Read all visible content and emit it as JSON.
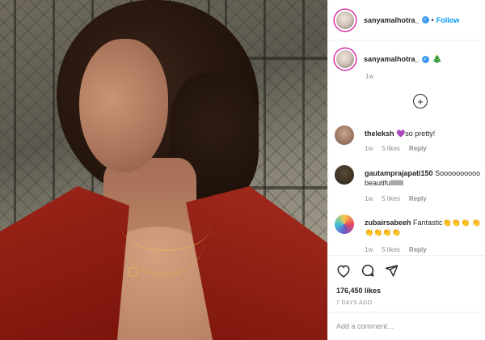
{
  "post": {
    "username": "sanyamalhotra_",
    "follow_label": "Follow",
    "header_dot": "•",
    "caption_emoji": "🎄",
    "caption_time": "1w",
    "verified_mark": "✓"
  },
  "comments": [
    {
      "user": "theleksh",
      "text": "💜so pretty!",
      "time": "1w",
      "likes": "5 likes",
      "reply": "Reply"
    },
    {
      "user": "gautamprajapati150",
      "text": "Soooooooooo beautifullllllll",
      "time": "1w",
      "likes": "5 likes",
      "reply": "Reply"
    },
    {
      "user": "zubairsabeeh",
      "text": "Fantastic👏👏👏 👏👏👏👏👏",
      "time": "1w",
      "likes": "5 likes",
      "reply": "Reply"
    }
  ],
  "load_more_symbol": "+",
  "stats": {
    "likes": "176,450 likes",
    "posted_ago": "7 DAYS AGO"
  },
  "add_comment": {
    "placeholder": "Add a comment..."
  },
  "icons": [
    "heart-icon",
    "comment-icon",
    "share-icon",
    "plus-circle-icon",
    "verified-icon"
  ],
  "colors": {
    "accent": "#0095f6",
    "verified": "#3897f0",
    "muted": "#8e8e8e",
    "border": "#efefef"
  }
}
